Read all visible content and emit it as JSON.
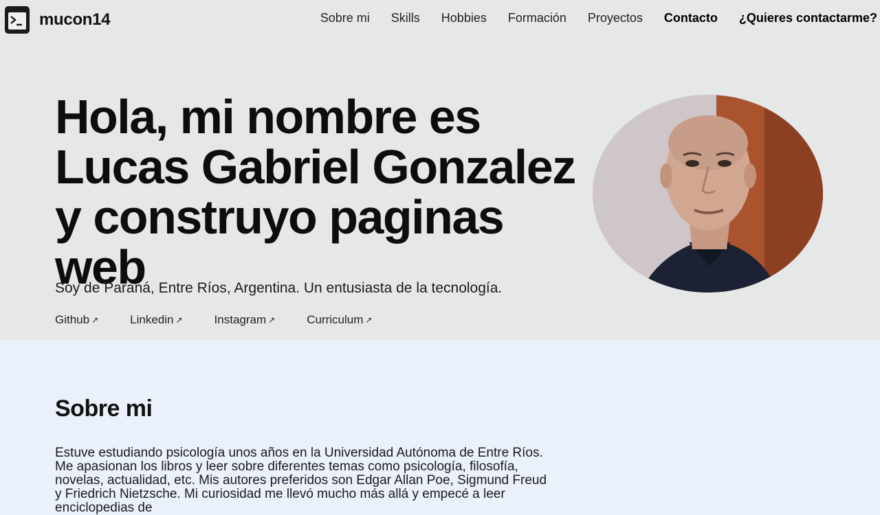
{
  "brand": {
    "name": "mucon14",
    "icon": "terminal-icon"
  },
  "nav": {
    "items": [
      "Sobre mi",
      "Skills",
      "Hobbies",
      "Formación",
      "Proyectos",
      "Contacto"
    ],
    "active": "Contacto",
    "cta": "¿Quieres contactarme?"
  },
  "hero": {
    "title": "Hola, mi nombre es Lucas Gabriel Gonzalez y construyo paginas web",
    "subtitle": "Soy de Paraná, Entre Ríos, Argentina. Un entusiasta de la tecnología.",
    "links": [
      {
        "label": "Github",
        "icon": "external-link-icon"
      },
      {
        "label": "Linkedin",
        "icon": "external-link-icon"
      },
      {
        "label": "Instagram",
        "icon": "external-link-icon"
      },
      {
        "label": "Curriculum",
        "icon": "external-link-icon"
      }
    ]
  },
  "about": {
    "title": "Sobre mi",
    "text": "Estuve estudiando psicología unos años en la Universidad Autónoma de Entre Ríos. Me apasionan los libros y leer sobre diferentes temas como psicología, filosofía, novelas, actualidad, etc. Mis autores preferidos son Edgar Allan Poe, Sigmund Freud y Friedrich Nietzsche. Mi curiosidad me llevó mucho más allá y empecé a leer enciclopedias de"
  },
  "colors": {
    "hero_bg": "#e6e7e7",
    "section_bg": "#eaf1fb",
    "text": "#111111"
  }
}
